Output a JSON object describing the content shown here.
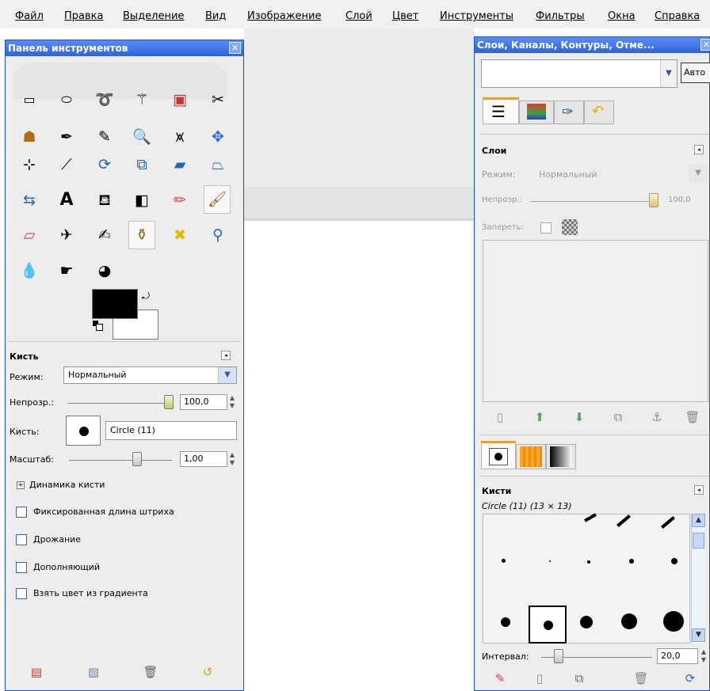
{
  "menubar": {
    "items": [
      "Файл",
      "Правка",
      "Выделение",
      "Вид",
      "Изображение",
      "Слой",
      "Цвет",
      "Инструменты",
      "Фильтры",
      "Окна",
      "Справка"
    ]
  },
  "toolbox": {
    "title": "Панель инструментов",
    "brush_section": {
      "title": "Кисть",
      "mode_label": "Режим:",
      "mode_value": "Нормальный",
      "opacity_label": "Непрозр.:",
      "opacity_value": "100,0",
      "opacity_fraction": 1.0,
      "brush_label": "Кисть:",
      "brush_name": "Circle (11)",
      "scale_label": "Масштаб:",
      "scale_value": "1,00",
      "dynamics_label": "Динамика кисти",
      "options": [
        "Фиксированная длина штриха",
        "Дрожание",
        "Дополняющий",
        "Взять цвет из градиента"
      ]
    }
  },
  "dock": {
    "title": "Слои, Каналы, Контуры, Отме...",
    "auto_button": "Авто",
    "layers": {
      "title": "Слои",
      "mode_label": "Режим:",
      "mode_value": "Нормальный",
      "opacity_label": "Непрозр.:",
      "opacity_value": "100,0",
      "lock_label": "Запереть:"
    },
    "brushes": {
      "title": "Кисти",
      "selected_info": "Circle (11) (13 × 13)",
      "spacing_label": "Интервал:",
      "spacing_value": "20,0"
    }
  },
  "colors": {
    "titlebar": "#2f63dc",
    "accent_tab": "#f39c1e",
    "foreground": "#000000",
    "background": "#ffffff"
  }
}
